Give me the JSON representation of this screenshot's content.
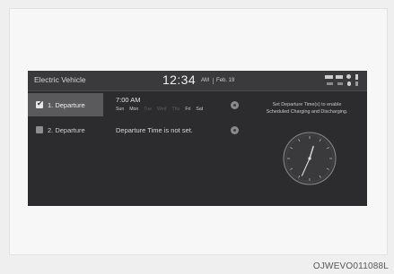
{
  "header": {
    "title": "Electric Vehicle",
    "clock": "12:34",
    "ampm": "AM",
    "date": "Feb. 19"
  },
  "departures": [
    {
      "label": "1. Departure",
      "checked": true,
      "time": "7:00 AM",
      "days": [
        {
          "label": "Sun",
          "active": true
        },
        {
          "label": "Mon",
          "active": true
        },
        {
          "label": "Tue",
          "active": false
        },
        {
          "label": "Wed",
          "active": false
        },
        {
          "label": "Thu",
          "active": false
        },
        {
          "label": "Fri",
          "active": true
        },
        {
          "label": "Sat",
          "active": true
        }
      ]
    },
    {
      "label": "2. Departure",
      "checked": false,
      "status": "Departure Time is not set."
    }
  ],
  "info": {
    "line1": "Set Departure Time(s) to enable",
    "line2": "Scheduled Charging and Discharging."
  },
  "analog_clock": {
    "hour": 12,
    "minute": 34
  },
  "figure_code": "OJWEVO011088L",
  "colors": {
    "screen_bg": "#2c2c2e",
    "selected_row": "#5a5a5c",
    "text": "#d7d7d7"
  }
}
